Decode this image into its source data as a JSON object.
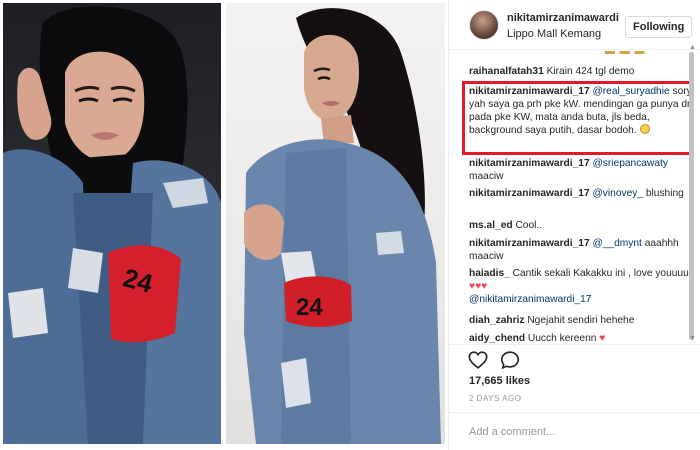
{
  "colors": {
    "highlight": "#e3192b",
    "mention": "#003569",
    "heart": "#ed4956",
    "secondary_text": "#999999",
    "border": "#efefef"
  },
  "photos": [
    {
      "armband_text": "24"
    },
    {
      "armband_text": "24"
    }
  ],
  "post": {
    "username": "nikitamirzanimawardi",
    "location": "Lippo Mall Kemang",
    "follow_label": "Following"
  },
  "comments": [
    {
      "user": "raihanalfatah31",
      "mention": "",
      "text": "Kirain 424 tgl demo",
      "hearts": 0,
      "has_emoji": false
    },
    {
      "user": "nikitamirzanimawardi_17",
      "mention": "@real_suryadhie",
      "text": "sory yah saya ga prh pke kW. mendingan ga punya dr pada pke KW, mata anda buta, jls beda, background saya putih, dasar bodoh.",
      "hearts": 0,
      "has_emoji": true
    },
    {
      "user": "nikitamirzanimawardi_17",
      "mention": "@sriepancawaty",
      "text": "maaciw",
      "hearts": 0,
      "has_emoji": false
    },
    {
      "user": "nikitamirzanimawardi_17",
      "mention": "@vinovey_",
      "text": "blushing",
      "hearts": 0,
      "has_emoji": false
    },
    {
      "user": "ms.al_ed",
      "mention": "",
      "text": "Cool..",
      "hearts": 0,
      "has_emoji": false
    },
    {
      "user": "nikitamirzanimawardi_17",
      "mention": "@__dmynt",
      "text": "aaahhh maaciw",
      "hearts": 0,
      "has_emoji": false
    },
    {
      "user": "haiadis_",
      "mention": "",
      "text": "Cantik sekali Kakakku ini , love youuuu",
      "hearts": 3,
      "trailing_mention": "@nikitamirzanimawardi_17",
      "has_emoji": false
    },
    {
      "user": "diah_zahriz",
      "mention": "",
      "text": "Ngejahit sendiri hehehe",
      "hearts": 0,
      "has_emoji": false
    },
    {
      "user": "aidy_chend",
      "mention": "",
      "text": "Uucch kereenn",
      "hearts": 1,
      "has_emoji": false
    }
  ],
  "actions": {
    "like_icon": "heart-outline-icon",
    "comment_icon": "comment-bubble-icon"
  },
  "likes": "17,665 likes",
  "timestamp": "2 DAYS AGO",
  "add_comment": {
    "placeholder": "Add a comment..."
  }
}
